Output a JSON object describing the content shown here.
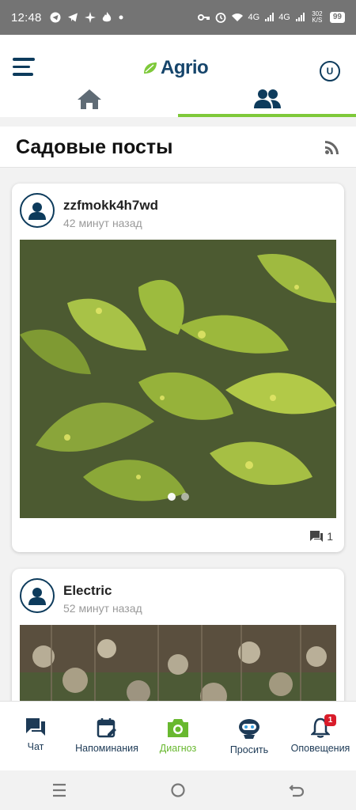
{
  "status_bar": {
    "time": "12:48",
    "network": "4G",
    "network2": "4G",
    "speed": "302 K/S",
    "battery": "99"
  },
  "header": {
    "app_name": "Agrio",
    "user_initial": "U"
  },
  "feed": {
    "title": "Садовые посты"
  },
  "posts": [
    {
      "author": "zzfmokk4h7wd",
      "time": "42 минут назад",
      "comments": "1"
    },
    {
      "author": "Electric",
      "time": "52 минут назад"
    }
  ],
  "bottom_nav": [
    {
      "label": "Чат",
      "icon": "chat-icon"
    },
    {
      "label": "Напоминания",
      "icon": "calendar-icon"
    },
    {
      "label": "Диагноз",
      "icon": "camera-icon"
    },
    {
      "label": "Просить",
      "icon": "robot-icon"
    },
    {
      "label": "Оповещения",
      "icon": "bell-icon",
      "badge": "1"
    }
  ],
  "colors": {
    "primary": "#0d3b5c",
    "accent": "#7ec93a",
    "badge": "#d91c2a"
  }
}
